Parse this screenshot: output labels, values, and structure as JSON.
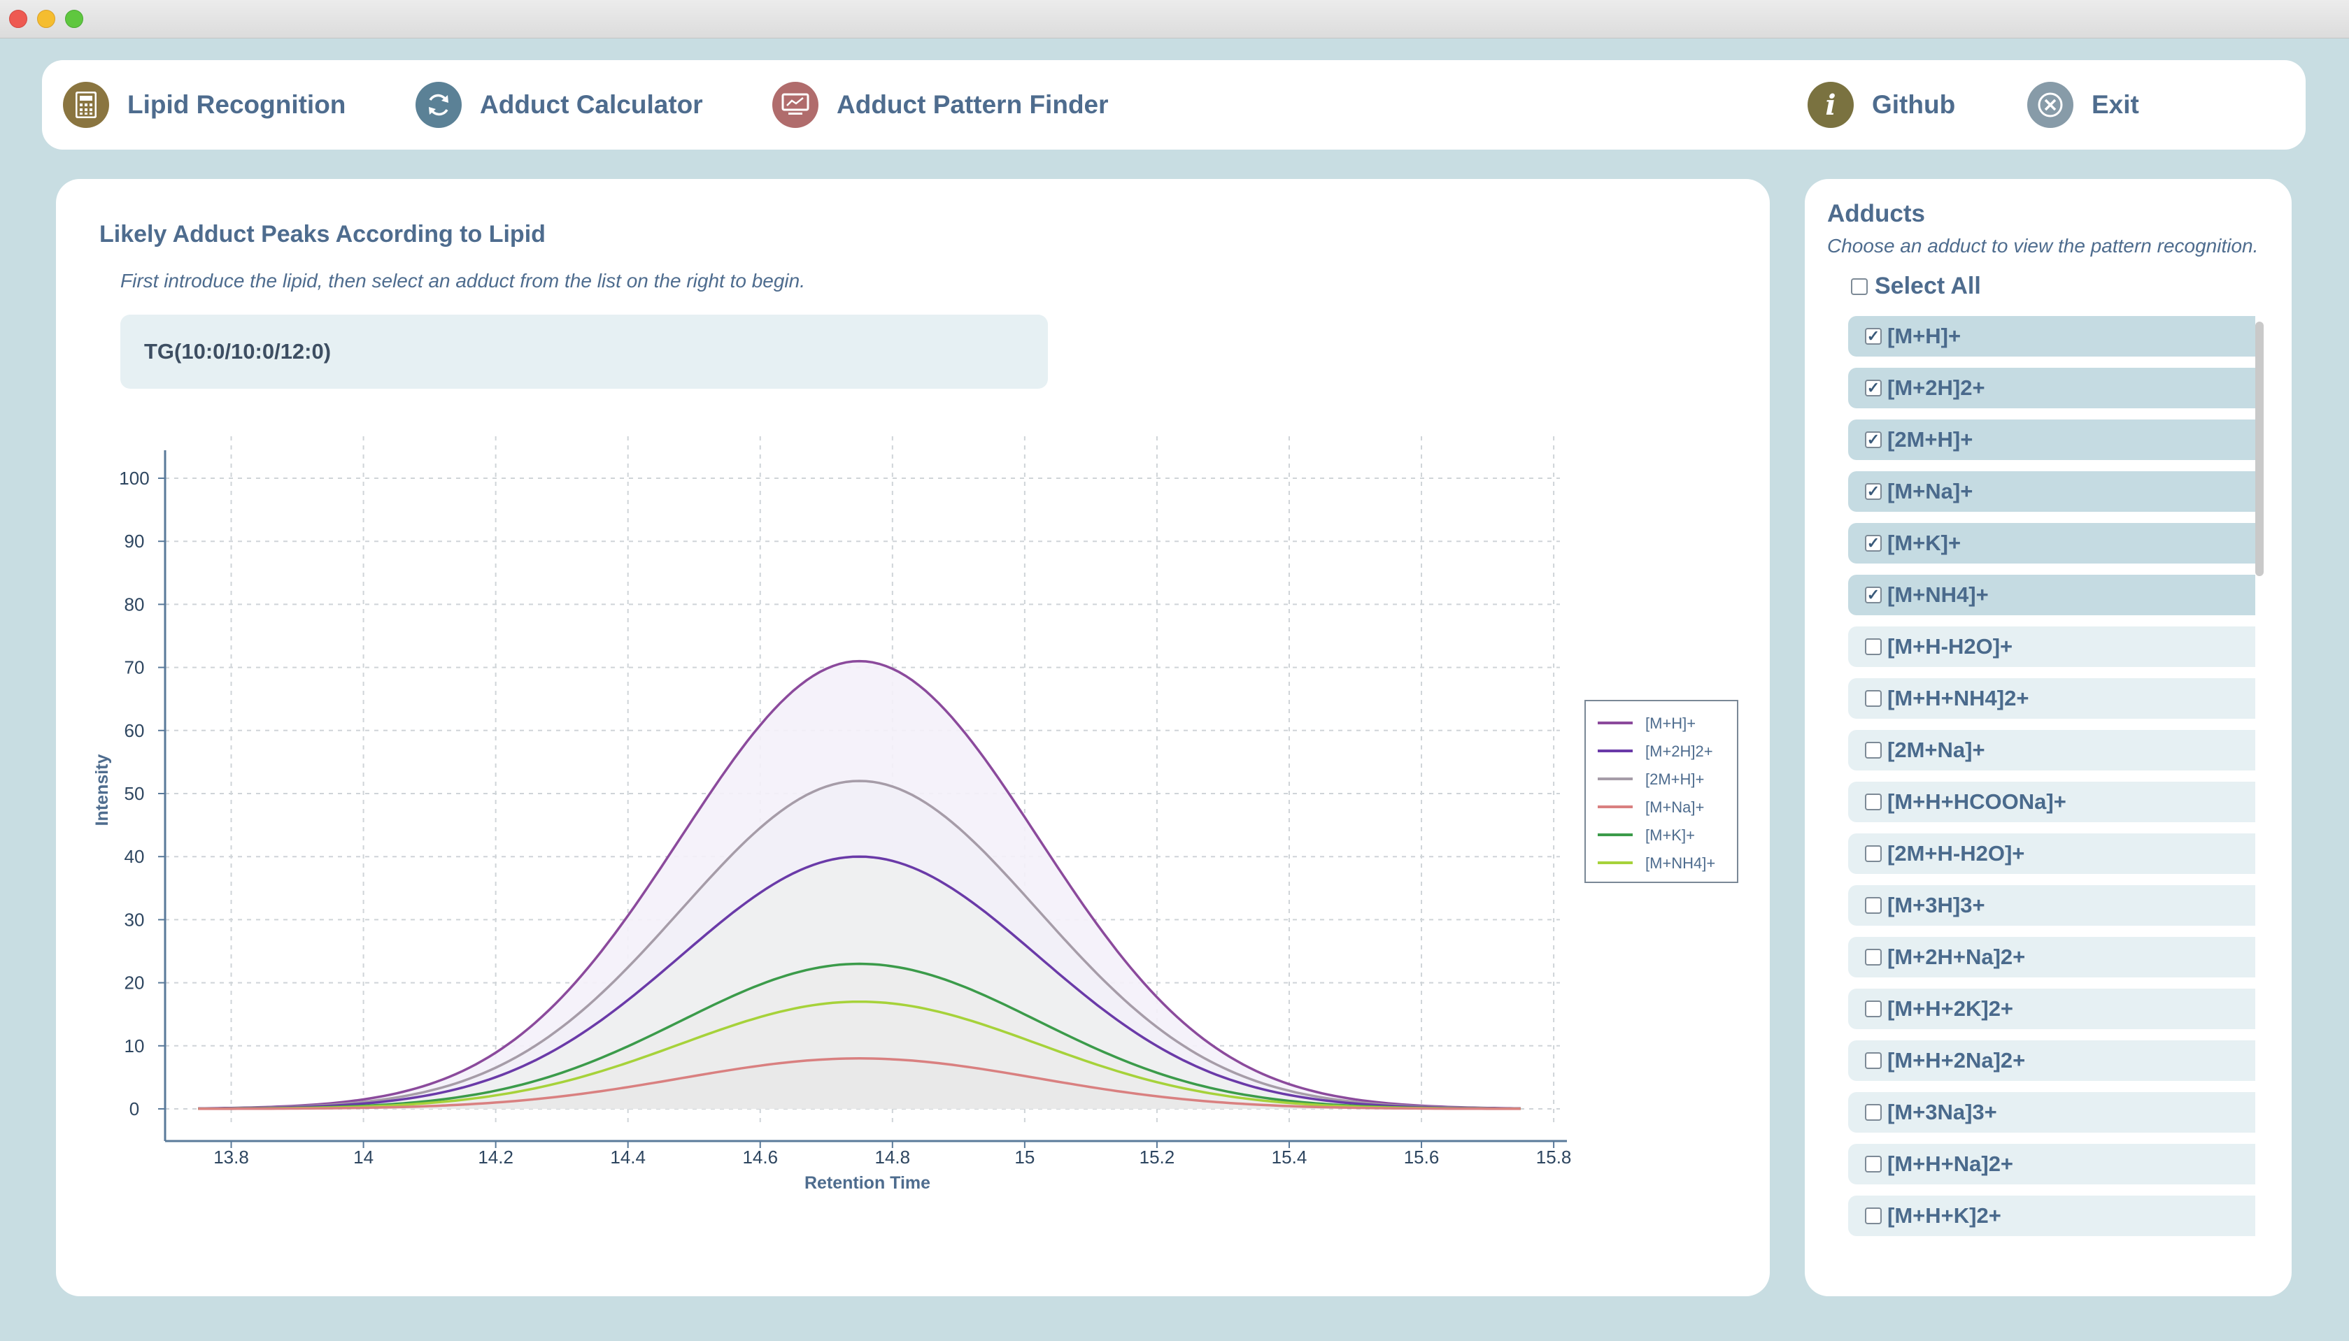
{
  "nav": {
    "items": [
      {
        "label": "Lipid Recognition",
        "icon": "calculator-icon",
        "color": "#8a7540"
      },
      {
        "label": "Adduct Calculator",
        "icon": "refresh-icon",
        "color": "#5b8196"
      },
      {
        "label": "Adduct Pattern Finder",
        "icon": "monitor-icon",
        "color": "#b06c6c"
      }
    ],
    "right_items": [
      {
        "label": "Github",
        "icon": "info-icon",
        "color": "#7a7240"
      },
      {
        "label": "Exit",
        "icon": "close-circle-icon",
        "color": "#879ba8"
      }
    ]
  },
  "main": {
    "title": "Likely Adduct Peaks According to Lipid",
    "instruction": "First introduce the lipid, then select an adduct from the list on the right to begin.",
    "lipid_value": "TG(10:0/10:0/12:0)"
  },
  "chart_data": {
    "type": "area",
    "title": "",
    "xlabel": "Retention Time",
    "ylabel": "Intensity",
    "xlim": [
      13.7,
      15.82
    ],
    "ylim": [
      0,
      100
    ],
    "xticks": [
      13.8,
      14,
      14.2,
      14.4,
      14.6,
      14.8,
      15,
      15.2,
      15.4,
      15.6,
      15.8
    ],
    "yticks": [
      0,
      10,
      20,
      30,
      40,
      50,
      60,
      70,
      80,
      90,
      100
    ],
    "grid": true,
    "legend_position": "right",
    "peak_center": 14.75,
    "x_range": [
      13.75,
      15.75
    ],
    "series": [
      {
        "name": "[M+H]+",
        "peak": 71,
        "color": "#8b4a9c"
      },
      {
        "name": "[M+2H]2+",
        "peak": 40,
        "color": "#6a3aa8"
      },
      {
        "name": "[2M+H]+",
        "peak": 52,
        "color": "#a69ca8"
      },
      {
        "name": "[M+Na]+",
        "peak": 8,
        "color": "#d98080"
      },
      {
        "name": "[M+K]+",
        "peak": 23,
        "color": "#3b9b4a"
      },
      {
        "name": "[M+NH4]+",
        "peak": 17,
        "color": "#a6d23a"
      }
    ]
  },
  "adducts": {
    "title": "Adducts",
    "subtitle": "Choose an adduct to view the pattern recognition.",
    "select_all_label": "Select All",
    "select_all_checked": false,
    "items": [
      {
        "label": "[M+H]+",
        "checked": true
      },
      {
        "label": "[M+2H]2+",
        "checked": true
      },
      {
        "label": "[2M+H]+",
        "checked": true
      },
      {
        "label": "[M+Na]+",
        "checked": true
      },
      {
        "label": "[M+K]+",
        "checked": true
      },
      {
        "label": "[M+NH4]+",
        "checked": true
      },
      {
        "label": "[M+H-H2O]+",
        "checked": false
      },
      {
        "label": "[M+H+NH4]2+",
        "checked": false
      },
      {
        "label": "[2M+Na]+",
        "checked": false
      },
      {
        "label": "[M+H+HCOONa]+",
        "checked": false
      },
      {
        "label": "[2M+H-H2O]+",
        "checked": false
      },
      {
        "label": "[M+3H]3+",
        "checked": false
      },
      {
        "label": "[M+2H+Na]2+",
        "checked": false
      },
      {
        "label": "[M+H+2K]2+",
        "checked": false
      },
      {
        "label": "[M+H+2Na]2+",
        "checked": false
      },
      {
        "label": "[M+3Na]3+",
        "checked": false
      },
      {
        "label": "[M+H+Na]2+",
        "checked": false
      },
      {
        "label": "[M+H+K]2+",
        "checked": false
      }
    ],
    "checked_bg": "#c5dbe2",
    "unchecked_bg": "#e6f0f3"
  }
}
